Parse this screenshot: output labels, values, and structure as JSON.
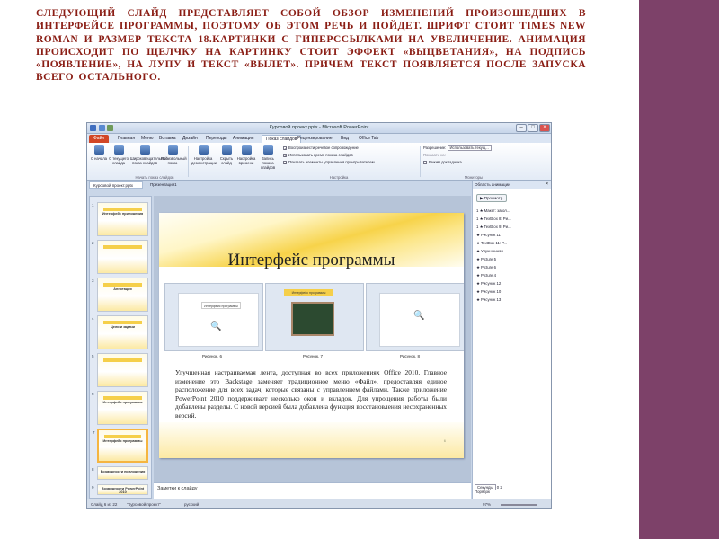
{
  "slide_text": "Следующий слайд представляет собой обзор изменений произошедших в интерфейсе программы, поэтому об этом речь и пойдет. Шрифт стоит Times New Roman и размер текста 18.Картинки с гиперссылками на увеличение. Анимация происходит по щелчку на картинку стоит эффект «Выцветания», на подпись «Появление», на лупу и текст «Вылет». Причем текст появляется после запуска всего остального.",
  "colors": {
    "title_text": "#8a1d14",
    "right_band": "#7d4169",
    "file_tab": "#d24726"
  },
  "window": {
    "title": "Курсовой проект.pptx - Microsoft PowerPoint"
  },
  "ribbon_tabs": [
    "Файл",
    "Главная",
    "Меню",
    "Вставка",
    "Дизайн",
    "Переходы",
    "Анимация",
    "Показ слайдов",
    "Рецензирование",
    "Вид",
    "Office Tab"
  ],
  "ribbon": {
    "buttons": [
      "С начала",
      "С текущего слайда",
      "Широковещательный показ слайдов",
      "Произвольный показ",
      "Настройка демонстрации",
      "Скрыть слайд",
      "Настройка времени",
      "Запись показа слайдов"
    ],
    "checkboxes": [
      "Воспроизвести речевое сопровождение",
      "Использовать время показа слайдов",
      "Показать элементы управления проигрывателем"
    ],
    "monitor": {
      "resolution_label": "Разрешение:",
      "resolution_value": "Использовать текущ...",
      "show_on": "Показать на:",
      "presenter_view": "Режим докладчика"
    },
    "groups": [
      "Начать показ слайдов",
      "Настройка",
      "Мониторы"
    ]
  },
  "doc_tabs": [
    "Курсовой проект.pptx",
    "Презентация1"
  ],
  "thumbnails": [
    {
      "num": "1",
      "title": "Интерфейс приложения"
    },
    {
      "num": "2",
      "title": ""
    },
    {
      "num": "3",
      "title": "Аннотация"
    },
    {
      "num": "4",
      "title": "Цели и задачи"
    },
    {
      "num": "5",
      "title": ""
    },
    {
      "num": "6",
      "title": "Интерфейс программы"
    },
    {
      "num": "7",
      "title": "Интерфейс программы"
    },
    {
      "num": "8",
      "title": "Возможности приложения"
    },
    {
      "num": "9",
      "title": "Возможности PowerPoint 2010"
    }
  ],
  "slide": {
    "title": "Интерфейс программы",
    "captions": [
      "Рисунок. 6",
      "Рисунок. 7",
      "Рисунок. 8"
    ],
    "mini_title": "Интерфейс программы",
    "body": "Улучшенная настраиваемая лента, доступная во всех приложениях Office 2010. Главное изменение это Backstage заменяет традиционное меню «Файл», предоставляя единое расположение для всех задач, которые связаны с управлением файлами. Также приложение PowerPoint 2010 поддерживает несколько окон и вкладок. Для упрощения работы были добавлены разделы. С новой версией была добавлена функция восстановления несохраненных версий.",
    "page_number": "6"
  },
  "notes_placeholder": "Заметки к слайду",
  "animation_pane": {
    "title": "Область анимации",
    "preview": "Просмотр",
    "items": [
      "1 ★ Макет: загол...",
      "1 ★ TextBox 8: Ри...",
      "1 ★ TextBox 9: Ри...",
      "★ Рисунок 11",
      "★ TextBox 11: Р...",
      "★ Улучшенная ...",
      "★ Picture 5",
      "★ Picture 6",
      "★ Picture 4",
      "★ Рисунок 12",
      "★ Рисунок 10",
      "★ Рисунок 13"
    ],
    "seconds_label": "Секунды",
    "page_nav": "0  2",
    "reorder": "Порядок"
  },
  "status": {
    "slide_info": "Слайд 6 из 22",
    "theme": "\"Курсовой проект\"",
    "lang": "русский",
    "zoom": "97%"
  }
}
